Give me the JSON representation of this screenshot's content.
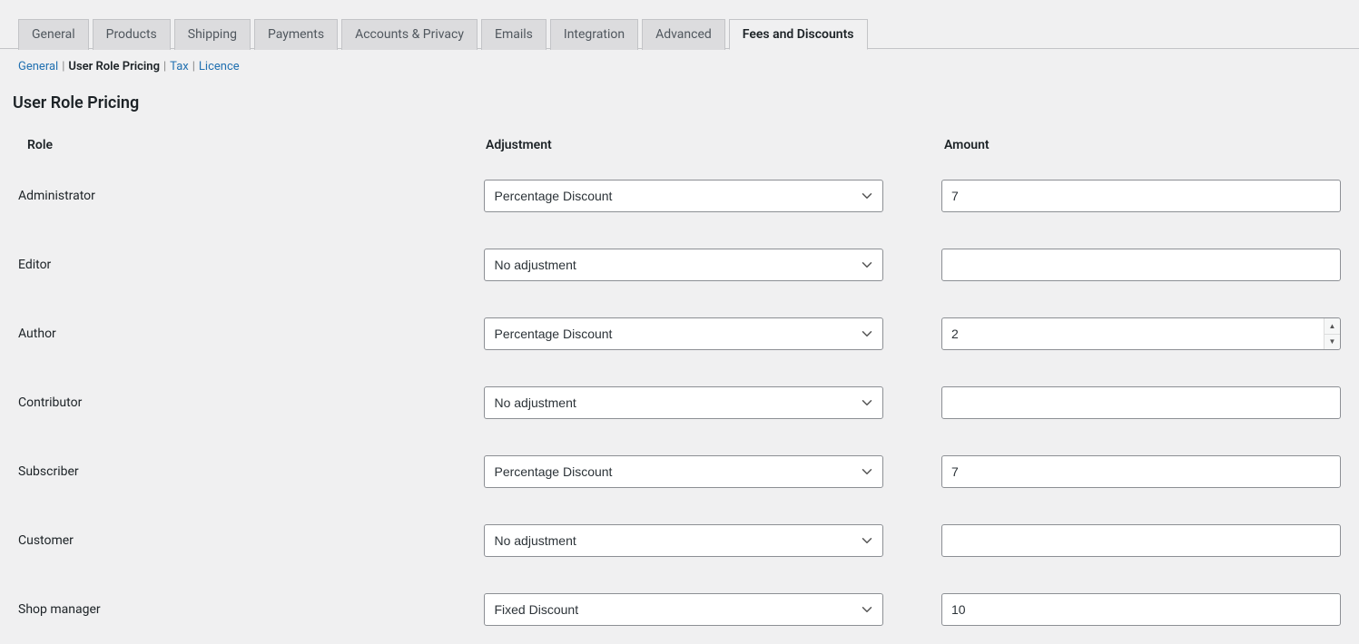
{
  "tabs": [
    {
      "label": "General",
      "active": false
    },
    {
      "label": "Products",
      "active": false
    },
    {
      "label": "Shipping",
      "active": false
    },
    {
      "label": "Payments",
      "active": false
    },
    {
      "label": "Accounts & Privacy",
      "active": false
    },
    {
      "label": "Emails",
      "active": false
    },
    {
      "label": "Integration",
      "active": false
    },
    {
      "label": "Advanced",
      "active": false
    },
    {
      "label": "Fees and Discounts",
      "active": true
    }
  ],
  "subnav": [
    {
      "label": "General",
      "current": false
    },
    {
      "label": "User Role Pricing",
      "current": true
    },
    {
      "label": "Tax",
      "current": false
    },
    {
      "label": "Licence",
      "current": false
    }
  ],
  "page_title": "User Role Pricing",
  "headers": {
    "role": "Role",
    "adjustment": "Adjustment",
    "amount": "Amount"
  },
  "adjustment_options": [
    "No adjustment",
    "Percentage Discount",
    "Fixed Discount"
  ],
  "rows": [
    {
      "role": "Administrator",
      "adjustment": "Percentage Discount",
      "amount": "7",
      "spinner": false
    },
    {
      "role": "Editor",
      "adjustment": "No adjustment",
      "amount": "",
      "spinner": false
    },
    {
      "role": "Author",
      "adjustment": "Percentage Discount",
      "amount": "2",
      "spinner": true
    },
    {
      "role": "Contributor",
      "adjustment": "No adjustment",
      "amount": "",
      "spinner": false
    },
    {
      "role": "Subscriber",
      "adjustment": "Percentage Discount",
      "amount": "7",
      "spinner": false
    },
    {
      "role": "Customer",
      "adjustment": "No adjustment",
      "amount": "",
      "spinner": false
    },
    {
      "role": "Shop manager",
      "adjustment": "Fixed Discount",
      "amount": "10",
      "spinner": false
    }
  ]
}
